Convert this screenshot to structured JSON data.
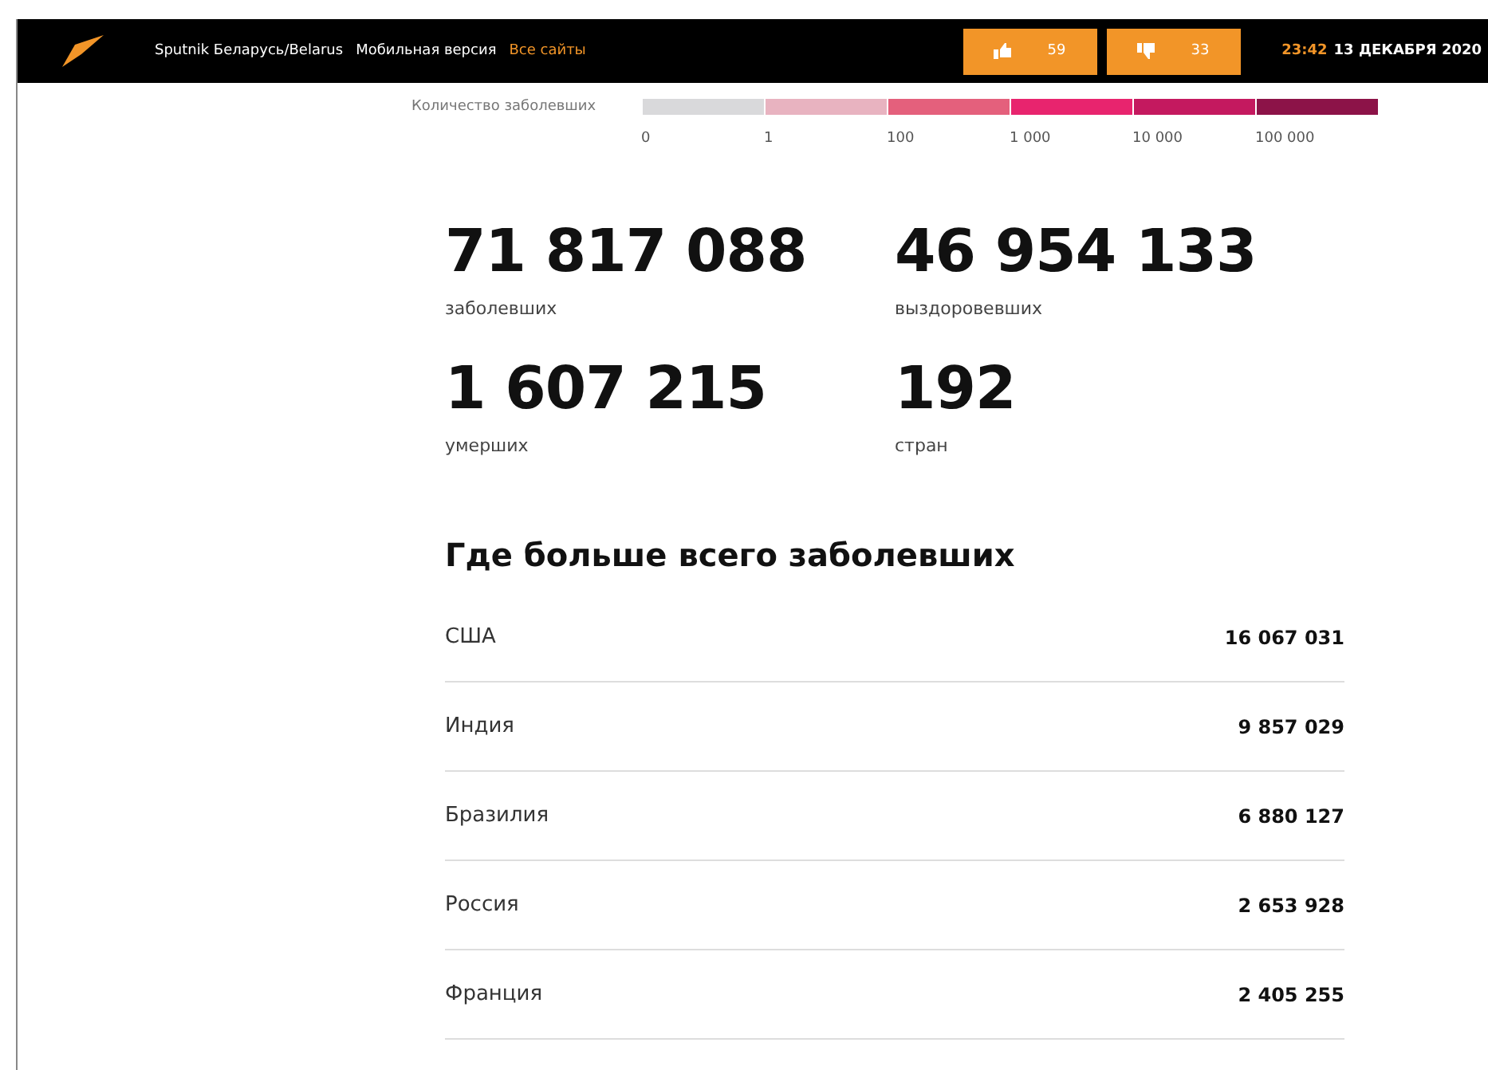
{
  "header": {
    "site": "Sputnik Беларусь/Belarus",
    "mobile": "Мобильная версия",
    "all_sites": "Все сайты",
    "likes": "59",
    "dislikes": "33",
    "time": "23:42",
    "date": "13 ДЕКАБРЯ 2020"
  },
  "legend": {
    "label": "Количество заболевших",
    "segments": [
      {
        "color": "#d9d9db",
        "tick": "0"
      },
      {
        "color": "#e8b3c0",
        "tick": "1"
      },
      {
        "color": "#e4607c",
        "tick": "100"
      },
      {
        "color": "#e8246e",
        "tick": "1 000"
      },
      {
        "color": "#c4195f",
        "tick": "10 000"
      },
      {
        "color": "#8c1348",
        "tick": "100 000"
      }
    ]
  },
  "stats": [
    {
      "value": "71 817 088",
      "label": "заболевших"
    },
    {
      "value": "46 954 133",
      "label": "выздоровевших"
    },
    {
      "value": "1 607 215",
      "label": "умерших"
    },
    {
      "value": "192",
      "label": "стран"
    }
  ],
  "ranking": {
    "title": "Где больше всего заболевших",
    "rows": [
      {
        "country": "США",
        "cases": "16 067 031"
      },
      {
        "country": "Индия",
        "cases": "9 857 029"
      },
      {
        "country": "Бразилия",
        "cases": "6 880 127"
      },
      {
        "country": "Россия",
        "cases": "2 653 928"
      },
      {
        "country": "Франция",
        "cases": "2 405 255"
      }
    ]
  }
}
